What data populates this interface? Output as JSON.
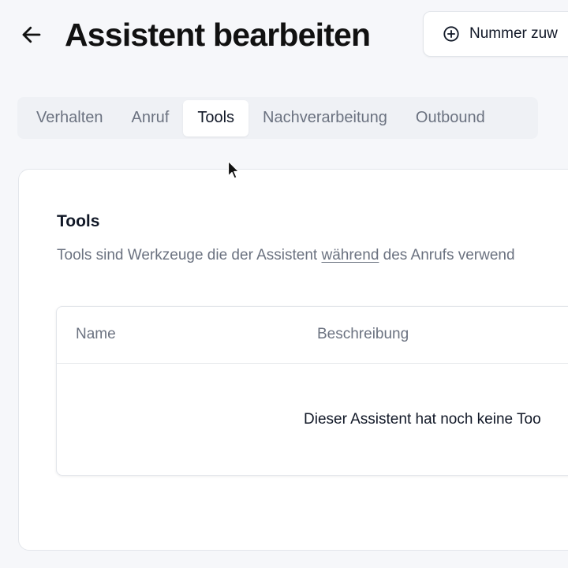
{
  "header": {
    "title": "Assistent bearbeiten",
    "assign_button_label": "Nummer zuw"
  },
  "tabs": [
    {
      "label": "Verhalten",
      "active": false
    },
    {
      "label": "Anruf",
      "active": false
    },
    {
      "label": "Tools",
      "active": true
    },
    {
      "label": "Nachverarbeitung",
      "active": false
    },
    {
      "label": "Outbound",
      "active": false
    }
  ],
  "tools_section": {
    "title": "Tools",
    "description_before": "Tools sind Werkzeuge die der Assistent ",
    "description_underlined": "während",
    "description_after": " des Anrufs verwend",
    "table": {
      "columns": [
        "Name",
        "Beschreibung"
      ],
      "empty_message": "Dieser Assistent hat noch keine Too"
    }
  },
  "icons": {
    "back": "arrow-left-icon",
    "assign": "plus-circle-icon",
    "cursor": "mouse-pointer-icon"
  }
}
